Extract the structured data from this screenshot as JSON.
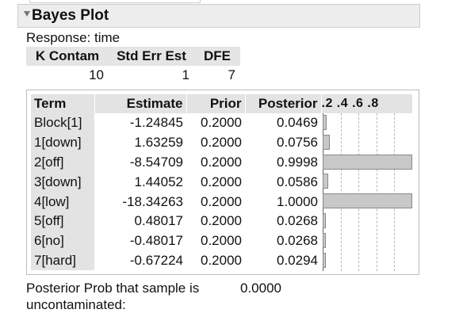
{
  "section": {
    "title": "Bayes Plot",
    "response_label": "Response: time"
  },
  "k_contam_table": {
    "headers": [
      "K Contam",
      "Std Err Est",
      "DFE"
    ],
    "values": [
      "10",
      "1",
      "7"
    ]
  },
  "bayes_table": {
    "headers": {
      "term": "Term",
      "estimate": "Estimate",
      "prior": "Prior",
      "posterior": "Posterior",
      "axis": ".2 .4 .6 .8"
    },
    "rows": [
      {
        "term": "Block[1]",
        "estimate": "-1.24845",
        "prior": "0.2000",
        "posterior": "0.0469",
        "posterior_value": 0.0469
      },
      {
        "term": "1[down]",
        "estimate": "1.63259",
        "prior": "0.2000",
        "posterior": "0.0756",
        "posterior_value": 0.0756
      },
      {
        "term": "2[off]",
        "estimate": "-8.54709",
        "prior": "0.2000",
        "posterior": "0.9998",
        "posterior_value": 0.9998
      },
      {
        "term": "3[down]",
        "estimate": "1.44052",
        "prior": "0.2000",
        "posterior": "0.0586",
        "posterior_value": 0.0586
      },
      {
        "term": "4[low]",
        "estimate": "-18.34263",
        "prior": "0.2000",
        "posterior": "1.0000",
        "posterior_value": 1.0
      },
      {
        "term": "5[off]",
        "estimate": "0.48017",
        "prior": "0.2000",
        "posterior": "0.0268",
        "posterior_value": 0.0268
      },
      {
        "term": "6[no]",
        "estimate": "-0.48017",
        "prior": "0.2000",
        "posterior": "0.0268",
        "posterior_value": 0.0268
      },
      {
        "term": "7[hard]",
        "estimate": "-0.67224",
        "prior": "0.2000",
        "posterior": "0.0294",
        "posterior_value": 0.0294
      }
    ]
  },
  "footer": {
    "label_line1": "Posterior Prob that sample is",
    "label_line2": "uncontaminated:",
    "value": "0.0000"
  },
  "colors": {
    "header_bg": "#e3e3e3",
    "bar_fill": "#c8c8c8",
    "bar_border": "#8a8a8a",
    "outline_bg": "#ededed"
  },
  "icons": {
    "disclosure": "triangle-down-icon"
  }
}
